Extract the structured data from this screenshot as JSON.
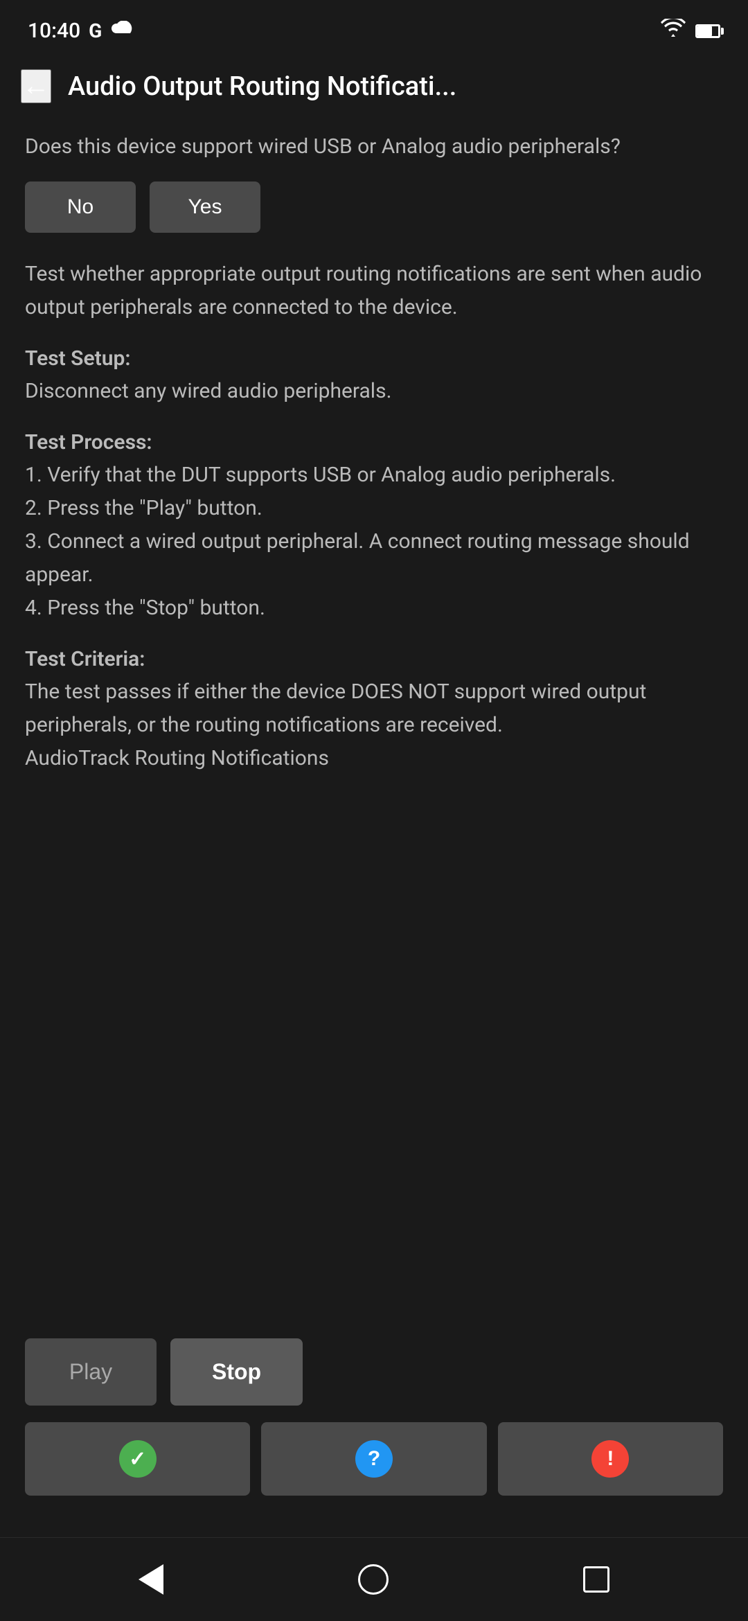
{
  "statusBar": {
    "time": "10:40",
    "googleLabel": "G"
  },
  "header": {
    "backLabel": "←",
    "title": "Audio Output Routing Notificati..."
  },
  "question": {
    "text": "Does this device support wired USB or Analog audio peripherals?"
  },
  "choiceButtons": {
    "no": "No",
    "yes": "Yes"
  },
  "description": "Test whether appropriate output routing notifications are sent when audio output peripherals are connected to the device.",
  "testSetup": {
    "title": "Test Setup:",
    "body": "Disconnect any wired audio peripherals."
  },
  "testProcess": {
    "title": "Test Process:",
    "body": "1. Verify that the DUT supports USB or Analog audio peripherals.\n2. Press the \"Play\" button.\n3. Connect a wired output peripheral. A connect routing message should appear.\n4. Press the \"Stop\" button."
  },
  "testCriteria": {
    "title": "Test Criteria:",
    "body": "The test passes if either the device DOES NOT support wired output peripherals, or the routing notifications are received.\nAudioTrack Routing Notifications"
  },
  "playback": {
    "playLabel": "Play",
    "stopLabel": "Stop"
  },
  "resultButtons": {
    "passIcon": "✓",
    "infoIcon": "?",
    "failIcon": "!"
  },
  "bottomNav": {
    "backTitle": "back",
    "homeTitle": "home",
    "recentTitle": "recent"
  }
}
